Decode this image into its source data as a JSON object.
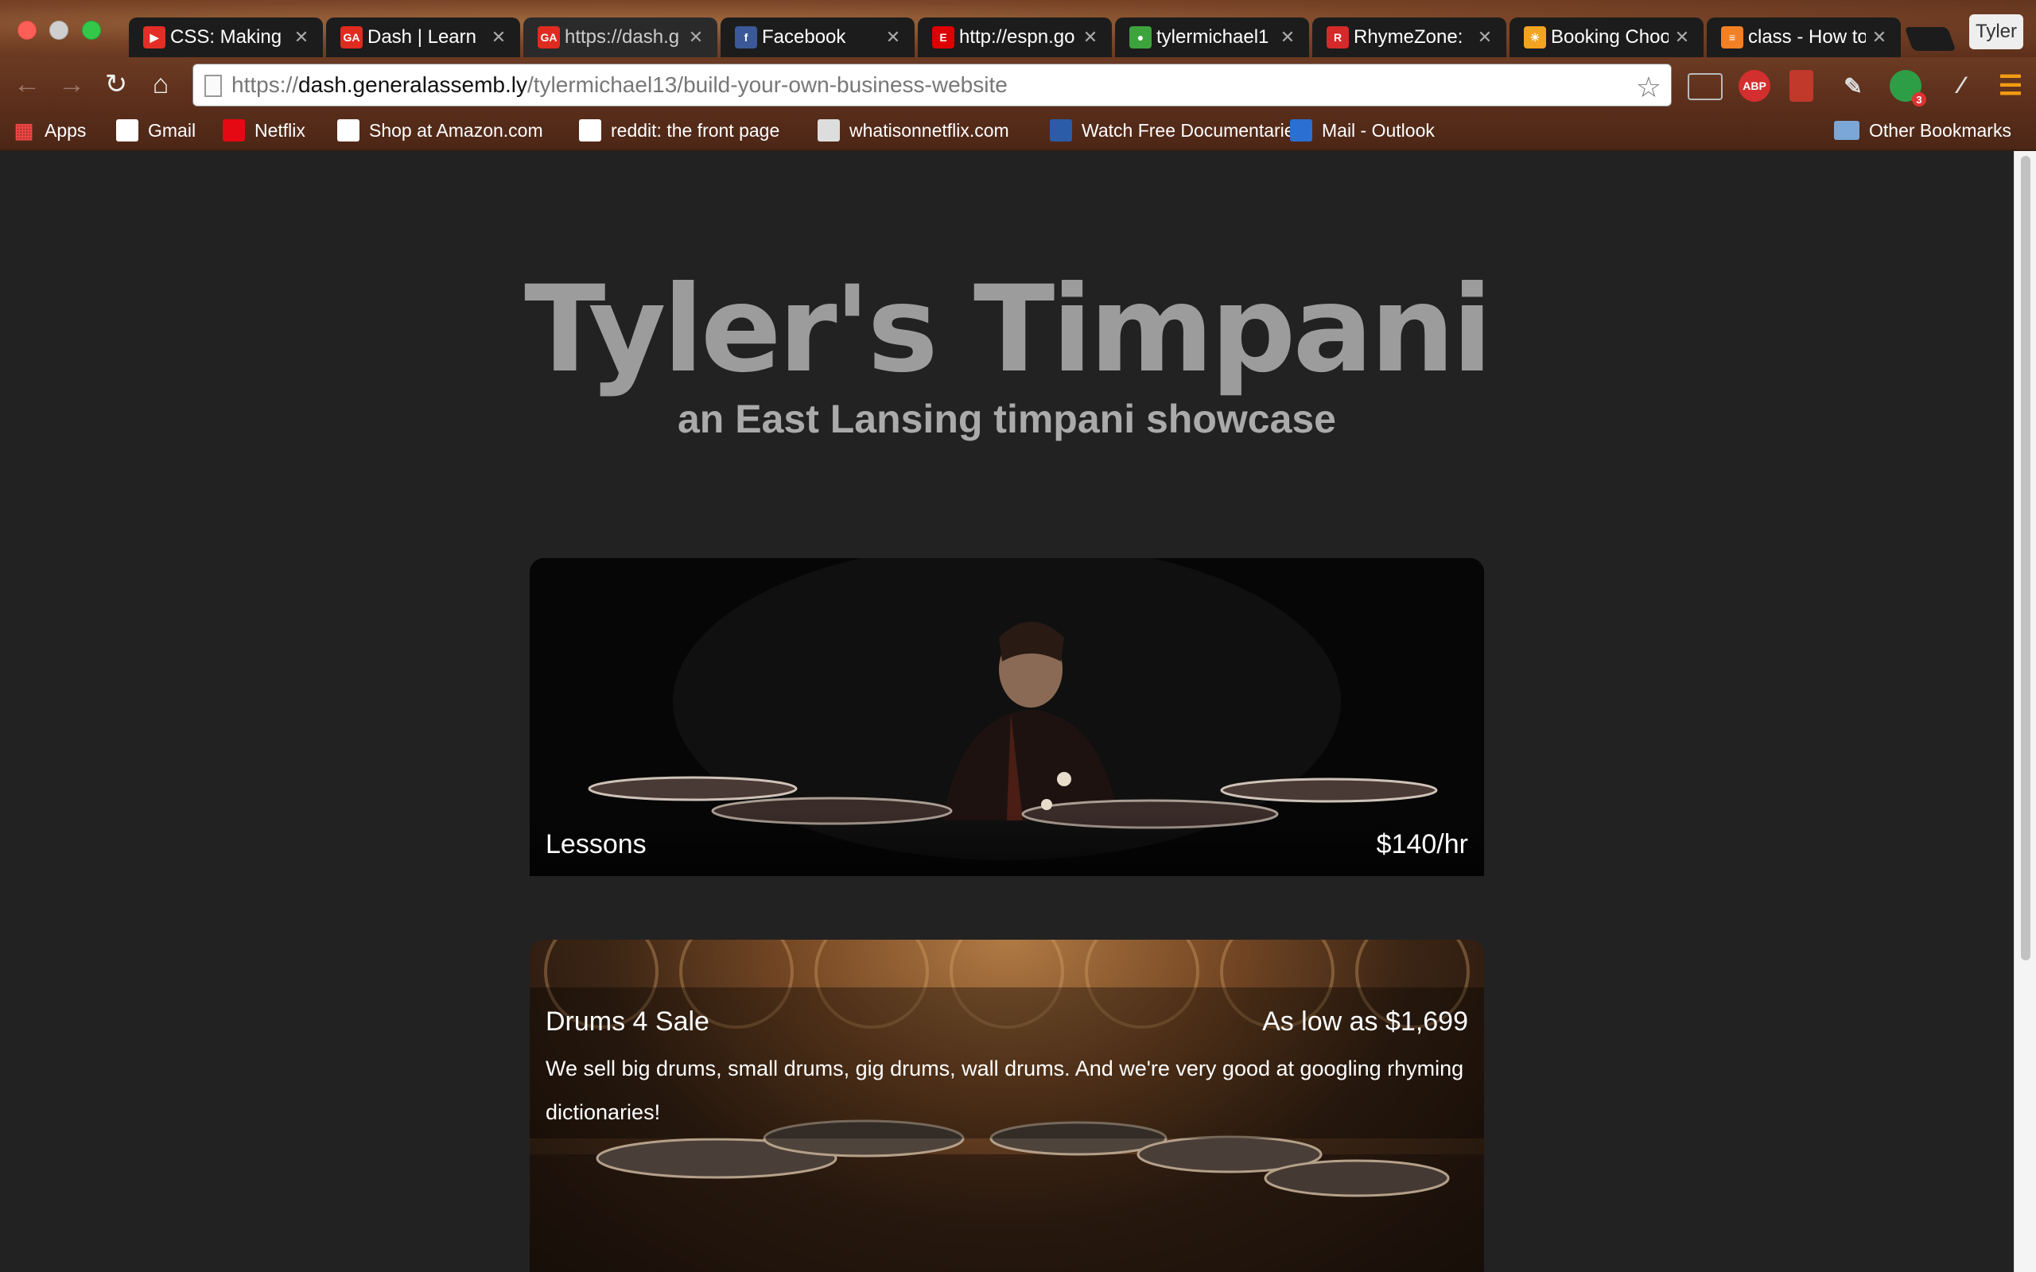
{
  "tabs": [
    {
      "title": "CSS: Making",
      "favicon": "youtube-icon",
      "color": "#e52d27",
      "glyph": "▶"
    },
    {
      "title": "Dash | Learn",
      "favicon": "ga-icon",
      "color": "#e02b20",
      "glyph": "GA"
    },
    {
      "title": "https://dash.g",
      "favicon": "ga-icon",
      "color": "#e02b20",
      "glyph": "GA"
    },
    {
      "title": "Facebook",
      "favicon": "facebook-icon",
      "color": "#3b5998",
      "glyph": "f"
    },
    {
      "title": "http://espn.go",
      "favicon": "espn-icon",
      "color": "#d00",
      "glyph": "E"
    },
    {
      "title": "tylermichael1",
      "favicon": "green-dot-icon",
      "color": "#3da33d",
      "glyph": "●"
    },
    {
      "title": "RhymeZone:",
      "favicon": "rhymezone-icon",
      "color": "#d42a2a",
      "glyph": "R"
    },
    {
      "title": "Booking Choo",
      "favicon": "sunrise-icon",
      "color": "#f2a320",
      "glyph": "☀"
    },
    {
      "title": "class - How to",
      "favicon": "stackoverflow-icon",
      "color": "#f48024",
      "glyph": "≡"
    }
  ],
  "profile_name": "Tyler",
  "url": {
    "scheme": "https://",
    "host": "dash.generalassemb.ly",
    "path": "/tylermichael13/build-your-own-business-website"
  },
  "bookmarks": [
    {
      "label": "Apps",
      "icon": "apps-grid-icon",
      "color": "#e44"
    },
    {
      "label": "Gmail",
      "icon": "gmail-icon",
      "color": "#fff"
    },
    {
      "label": "Netflix",
      "icon": "netflix-icon",
      "color": "#e50914"
    },
    {
      "label": "Shop at Amazon.com",
      "icon": "amazon-icon",
      "color": "#fff"
    },
    {
      "label": "reddit: the front page",
      "icon": "reddit-icon",
      "color": "#fff"
    },
    {
      "label": "whatisonnetflix.com",
      "icon": "film-icon",
      "color": "#ddd"
    },
    {
      "label": "Watch Free Documentaries",
      "icon": "dh-icon",
      "color": "#2a5ca8"
    },
    {
      "label": "Mail - Outlook",
      "icon": "mail-icon",
      "color": "#2a6fd1"
    }
  ],
  "other_bookmarks": "Other Bookmarks",
  "extensions": {
    "abp": "ABP",
    "badge": "3"
  },
  "site": {
    "title": "Tyler's Timpani",
    "subtitle": "an East Lansing timpani showcase",
    "lessons": {
      "label": "Lessons",
      "price": "$140/hr"
    },
    "drums": {
      "label": "Drums 4 Sale",
      "price": "As low as $1,699",
      "description": "We sell big drums, small drums, gig drums, wall drums. And we're very good at googling rhyming dictionaries!"
    }
  }
}
